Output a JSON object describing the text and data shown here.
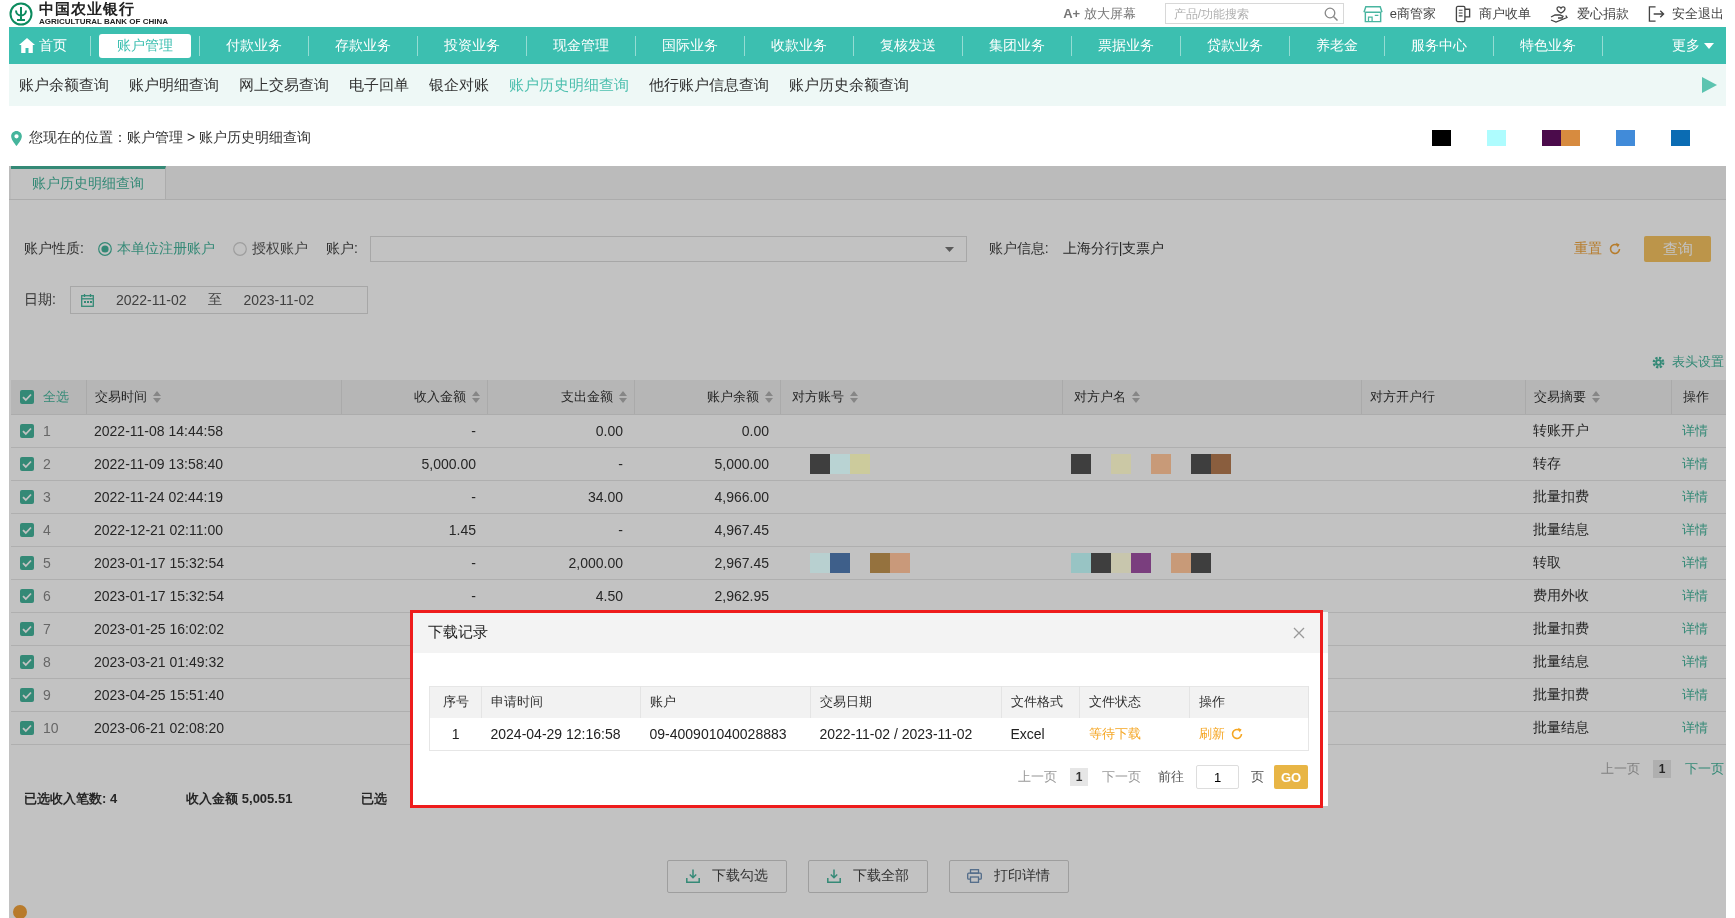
{
  "header": {
    "logo": {
      "title": "中国农业银行",
      "subtitle": "AGRICULTURAL BANK OF CHINA"
    },
    "zoom_button": "**A+** 放大屏幕",
    "search": {
      "placeholder": "产品/功能搜索"
    },
    "links": [
      {
        "kind": "shop",
        "label": "e商管家"
      },
      {
        "kind": "terminal",
        "label": "商户收单"
      },
      {
        "kind": "charity",
        "label": "爱心捐款"
      },
      {
        "kind": "exit",
        "label": "安全退出"
      }
    ]
  },
  "nav": {
    "items": [
      {
        "kind": "home",
        "label": "首页",
        "selected": false
      },
      {
        "kind": "menu",
        "label": "账户管理",
        "selected": true
      },
      {
        "kind": "menu",
        "label": "付款业务",
        "selected": false
      },
      {
        "kind": "menu",
        "label": "存款业务",
        "selected": false
      },
      {
        "kind": "menu",
        "label": "投资业务",
        "selected": false
      },
      {
        "kind": "menu",
        "label": "现金管理",
        "selected": false
      },
      {
        "kind": "menu",
        "label": "国际业务",
        "selected": false
      },
      {
        "kind": "menu",
        "label": "收款业务",
        "selected": false
      },
      {
        "kind": "menu",
        "label": "复核发送",
        "selected": false
      },
      {
        "kind": "menu",
        "label": "集团业务",
        "selected": false
      },
      {
        "kind": "menu",
        "label": "票据业务",
        "selected": false
      },
      {
        "kind": "menu",
        "label": "贷款业务",
        "selected": false
      },
      {
        "kind": "menu",
        "label": "养老金",
        "selected": false
      },
      {
        "kind": "menu",
        "label": "服务中心",
        "selected": false
      },
      {
        "kind": "menu",
        "label": "特色业务",
        "selected": false
      },
      {
        "kind": "more",
        "label": "更多",
        "selected": false
      }
    ]
  },
  "subnav": {
    "items": [
      {
        "label": "账户余额查询",
        "selected": false
      },
      {
        "label": "账户明细查询",
        "selected": false
      },
      {
        "label": "网上交易查询",
        "selected": false
      },
      {
        "label": "电子回单",
        "selected": false
      },
      {
        "label": "银企对账",
        "selected": false
      },
      {
        "label": "账户历史明细查询",
        "selected": true
      },
      {
        "label": "他行账户信息查询",
        "selected": false
      },
      {
        "label": "账户历史余额查询",
        "selected": false
      }
    ]
  },
  "breadcrumb": {
    "text": "您现在的位置：账户管理 > 账户历史明细查询",
    "mosaic": [
      [
        {
          "color": "#000000"
        }
      ],
      [
        {
          "color": "#aefcfe"
        }
      ],
      [
        {
          "color": "#4b0b4b"
        },
        {
          "color": "#d78b3f"
        }
      ],
      [
        {
          "color": "#418bd9"
        }
      ],
      [
        {
          "color": "#0b6cb3"
        }
      ]
    ]
  },
  "tabs": [
    {
      "label": "账户历史明细查询",
      "selected": true
    }
  ],
  "filters": {
    "account_type": {
      "label": "账户性质:",
      "options": [
        {
          "label": "本单位注册账户",
          "selected": true
        },
        {
          "label": "授权账户",
          "selected": false
        }
      ]
    },
    "account": {
      "label": "账户:"
    },
    "account_info": {
      "label": "账户信息:",
      "value": "上海分行|支票户"
    },
    "reset": "重置",
    "query": "查询",
    "date": {
      "label": "日期:",
      "start": "2022-11-02",
      "separator": "至",
      "end": "2023-11-02"
    }
  },
  "column_settings": "表头设置",
  "table": {
    "select_all": {
      "label": "全选",
      "checked": true
    },
    "columns": [
      {
        "label": "交易时间",
        "kind": "text",
        "sortable": true
      },
      {
        "label": "收入金额",
        "kind": "amount",
        "sortable": true
      },
      {
        "label": "支出金额",
        "kind": "amount",
        "sortable": true
      },
      {
        "label": "账户余额",
        "kind": "amount",
        "sortable": true
      },
      {
        "label": "对方账号",
        "kind": "mosaic",
        "sortable": true
      },
      {
        "label": "对方户名",
        "kind": "mosaic",
        "sortable": true
      },
      {
        "label": "对方开户行",
        "kind": "text",
        "sortable": false
      },
      {
        "label": "交易摘要",
        "kind": "text",
        "sortable": true
      },
      {
        "label": "操作",
        "kind": "link",
        "sortable": false
      }
    ],
    "rows": [
      {
        "index": "1",
        "checked": true,
        "time": "2022-11-08 14:44:58",
        "income": "-",
        "expense": "0.00",
        "balance": "0.00",
        "summary": "转账开户",
        "action": "详情"
      },
      {
        "index": "2",
        "checked": true,
        "time": "2022-11-09 13:58:40",
        "income": "5,000.00",
        "expense": "-",
        "balance": "5,000.00",
        "counterparty_account": [
          [
            {
              "color": "#3e3e3e"
            },
            {
              "color": "#b9d3d3"
            },
            {
              "color": "#cccb9c"
            }
          ]
        ],
        "counterparty_name": [
          [
            {
              "color": "#3e3e3e"
            }
          ],
          [
            {
              "color": "#cbc8a5"
            }
          ],
          [
            {
              "color": "#c89a78"
            }
          ],
          [
            {
              "color": "#3e3e3e"
            },
            {
              "color": "#8a5e3e"
            }
          ]
        ],
        "summary": "转存",
        "action": "详情"
      },
      {
        "index": "3",
        "checked": true,
        "time": "2022-11-24 02:44:19",
        "income": "-",
        "expense": "34.00",
        "balance": "4,966.00",
        "summary": "批量扣费",
        "action": "详情"
      },
      {
        "index": "4",
        "checked": true,
        "time": "2022-12-21 02:11:00",
        "income": "1.45",
        "expense": "-",
        "balance": "4,967.45",
        "summary": "批量结息",
        "action": "详情"
      },
      {
        "index": "5",
        "checked": true,
        "time": "2023-01-17 15:32:54",
        "income": "-",
        "expense": "2,000.00",
        "balance": "2,967.45",
        "counterparty_account": [
          [
            {
              "color": "#b8d0d0"
            },
            {
              "color": "#3e5f8a"
            }
          ],
          [
            {
              "color": "#95723e"
            },
            {
              "color": "#c9997a"
            }
          ]
        ],
        "counterparty_name": [
          [
            {
              "color": "#98c4c4"
            },
            {
              "color": "#3e3e3e"
            },
            {
              "color": "#c8c6ad"
            },
            {
              "color": "#7a3e7e"
            }
          ],
          [
            {
              "color": "#c89a78"
            },
            {
              "color": "#3e3e3e"
            }
          ]
        ],
        "summary": "转取",
        "action": "详情"
      },
      {
        "index": "6",
        "checked": true,
        "time": "2023-01-17 15:32:54",
        "income": "-",
        "expense": "4.50",
        "balance": "2,962.95",
        "summary": "费用外收",
        "action": "详情"
      },
      {
        "index": "7",
        "checked": true,
        "time": "2023-01-25 16:02:02",
        "summary": "批量扣费",
        "action": "详情"
      },
      {
        "index": "8",
        "checked": true,
        "time": "2023-03-21 01:49:32",
        "summary": "批量结息",
        "action": "详情"
      },
      {
        "index": "9",
        "checked": true,
        "time": "2023-04-25 15:51:40",
        "summary": "批量扣费",
        "action": "详情"
      },
      {
        "index": "10",
        "checked": true,
        "time": "2023-06-21 02:08:20",
        "summary": "批量结息",
        "action": "详情"
      }
    ],
    "pagination": {
      "prev": {
        "label": "上一页",
        "disabled": true
      },
      "page": {
        "label": "1",
        "selected": true
      },
      "next": {
        "label": "下一页",
        "disabled": false
      }
    }
  },
  "summary": [
    "已选收入笔数: 4",
    "收入金额 5,005.51",
    "已选"
  ],
  "actions": [
    {
      "kind": "download",
      "label": "下载勾选"
    },
    {
      "kind": "download",
      "label": "下载全部"
    },
    {
      "kind": "print",
      "label": "打印详情"
    }
  ],
  "dialog": {
    "title": "下载记录",
    "columns": [
      {
        "label": "序号",
        "kind": "index"
      },
      {
        "label": "申请时间",
        "kind": "text"
      },
      {
        "label": "账户",
        "kind": "text"
      },
      {
        "label": "交易日期",
        "kind": "text"
      },
      {
        "label": "文件格式",
        "kind": "text"
      },
      {
        "label": "文件状态",
        "kind": "status"
      },
      {
        "label": "操作",
        "kind": "action"
      }
    ],
    "rows": [
      {
        "index": "1",
        "time": "2024-04-29 12:16:58",
        "account": "09-400901040028883",
        "date_range": "2022-11-02 / 2023-11-02",
        "format": "Excel",
        "status": "等待下载",
        "action": "刷新"
      }
    ],
    "pagination": {
      "prev": {
        "label": "上一页",
        "disabled": true
      },
      "page": {
        "label": "1",
        "selected": true
      },
      "next": {
        "label": "下一页",
        "disabled": true
      },
      "goto_label": "前往",
      "goto_value": "1",
      "page_suffix": "页",
      "go": "GO"
    }
  }
}
